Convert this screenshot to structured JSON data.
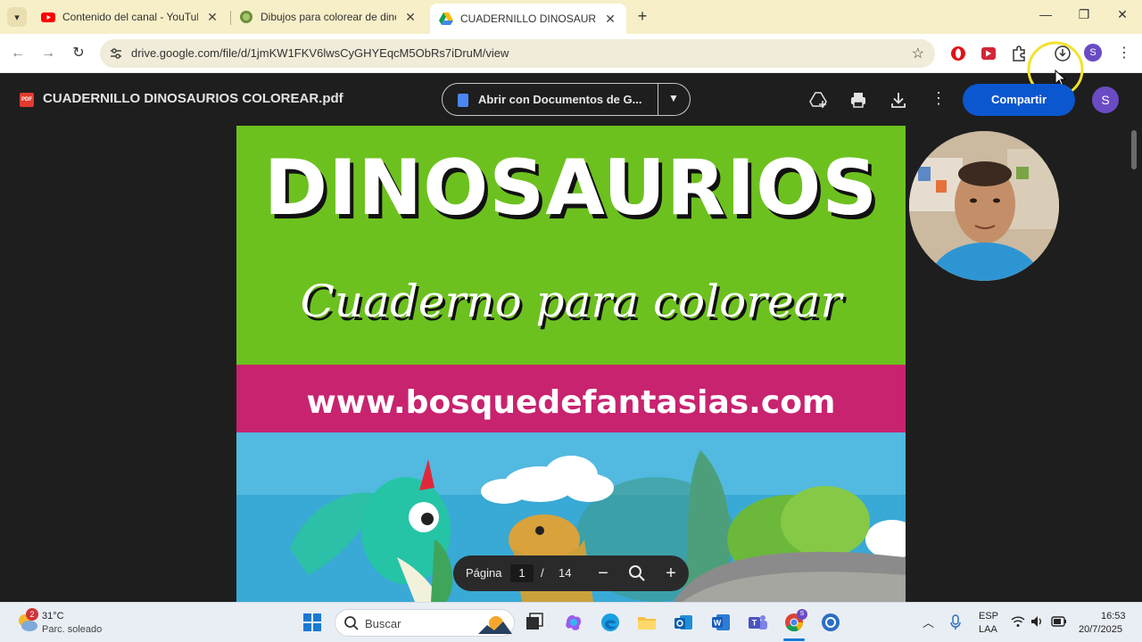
{
  "browser": {
    "tabs": [
      {
        "title": "Contenido del canal - YouTube",
        "favicon": "youtube-icon",
        "active": false
      },
      {
        "title": "Dibujos para colorear de dinosa",
        "favicon": "globe-icon",
        "active": false
      },
      {
        "title": "CUADERNILLO DINOSAURIOS C",
        "favicon": "google-drive-icon",
        "active": true
      }
    ],
    "close_glyph": "✕",
    "new_tab_glyph": "+",
    "url": "drive.google.com/file/d/1jmKW1FKV6lwsCyGHYEqcM5ObRs7iDruM/view",
    "profile_initial": "S"
  },
  "drive": {
    "file_name": "CUADERNILLO DINOSAURIOS COLOREAR.pdf",
    "file_type_badge": "PDF",
    "open_with_label": "Abrir con Documentos de G...",
    "share_label": "Compartir",
    "avatar_initial": "S"
  },
  "document": {
    "headline": "DINOSAURIOS",
    "subtitle": "Cuaderno para colorear",
    "website": "www.bosquedefantasias.com"
  },
  "pager": {
    "label": "Página",
    "current": "1",
    "separator": "/",
    "total": "14"
  },
  "taskbar": {
    "temperature": "31°C",
    "condition": "Parc. soleado",
    "weather_badge": "2",
    "search_placeholder": "Buscar",
    "language_line1": "ESP",
    "language_line2": "LAA",
    "time": "16:53",
    "date": "20/7/2025"
  },
  "colors": {
    "green_band": "#6cc11f",
    "pink_band": "#c8236f",
    "share_blue": "#0b57d0",
    "tabstrip": "#f7efc8"
  }
}
